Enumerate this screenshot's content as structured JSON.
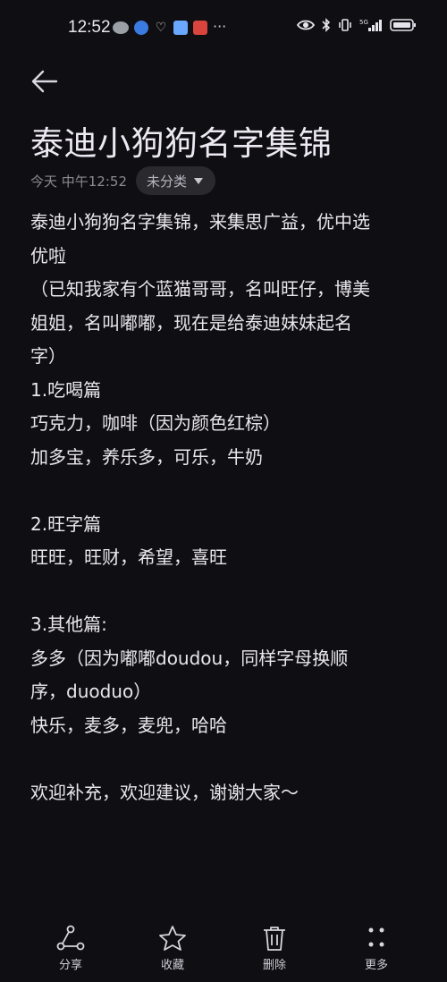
{
  "status_bar": {
    "time": "12:52",
    "more": "···"
  },
  "note": {
    "title": "泰迪小狗狗名字集锦",
    "date": "今天 中午12:52",
    "category": "未分类",
    "lines": [
      "泰迪小狗狗名字集锦，来集思广益，优中选",
      "优啦",
      "（已知我家有个蓝猫哥哥，名叫旺仔，博美",
      "姐姐，名叫嘟嘟，现在是给泰迪妹妹起名",
      "字）",
      "1.吃喝篇",
      "巧克力，咖啡（因为颜色红棕）",
      "加多宝，养乐多，可乐，牛奶",
      "",
      "2.旺字篇",
      "旺旺，旺财，希望，喜旺",
      "",
      "3.其他篇:",
      "多多（因为嘟嘟doudou，同样字母换顺",
      "序，duoduo）",
      "快乐，麦多，麦兜，哈哈",
      "",
      "欢迎补充，欢迎建议，谢谢大家～"
    ]
  },
  "toolbar": {
    "share_label": "分享",
    "favorite_label": "收藏",
    "delete_label": "删除",
    "more_label": "更多"
  }
}
